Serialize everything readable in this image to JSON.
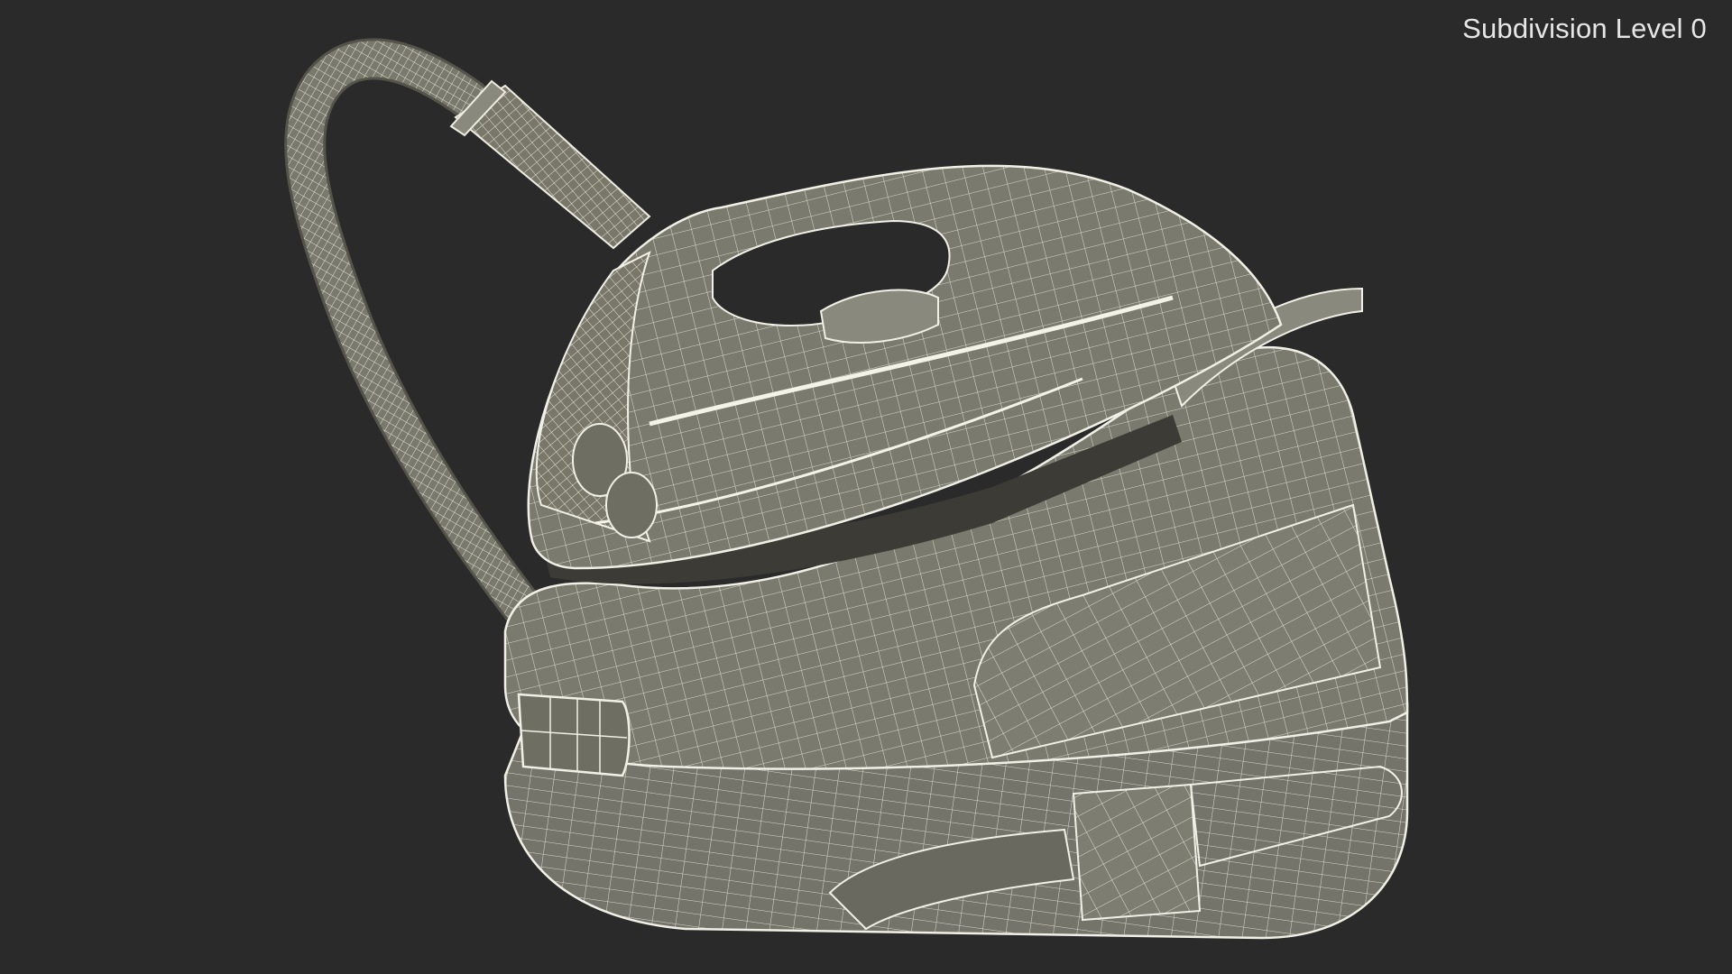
{
  "viewport": {
    "overlay_label": "Subdivision Level 0",
    "background_color": "#2a2a2a",
    "mesh_fill_color": "#7c7b70",
    "wire_color": "#f1f0e6",
    "subject": "steam-generator-iron-wireframe"
  }
}
